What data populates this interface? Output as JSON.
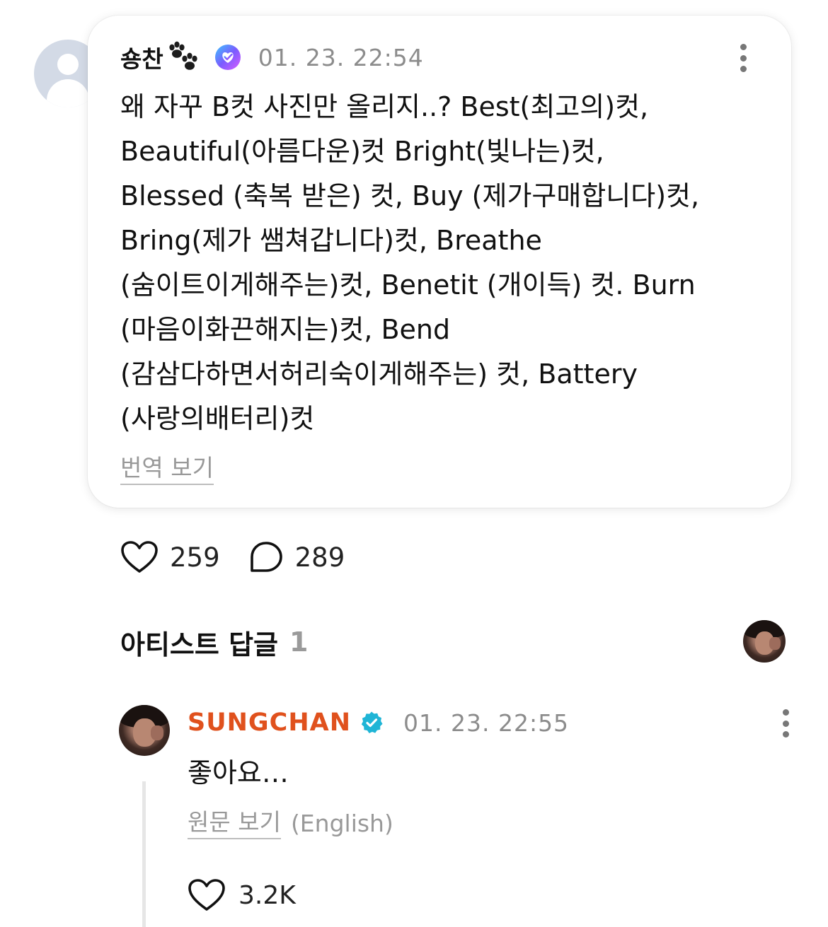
{
  "comment": {
    "author": "숑찬",
    "author_emoji": "paw-prints-icon",
    "badge_icon": "verified-fan-badge-icon",
    "time": "01. 23. 22:54",
    "lines": [
      "왜 자꾸 B컷 사진만 올리지..? Best(최고의)컷,",
      "Beautiful(아름다운)컷 Bright(빛나는)컷,",
      "Blessed (축복 받은) 컷, Buy (제가구매합니다)컷,",
      "Bring(제가 쌤쳐갑니다)컷, Breathe",
      "(숨이트이게해주는)컷, Benetit (개이득) 컷. Burn",
      "(마음이화끈해지는)컷, Bend",
      "(감삼다하면서허리숙이게해주는) 컷, Battery",
      "(사랑의배터리)컷"
    ],
    "translate_label": "번역 보기",
    "likes": "259",
    "replies": "289"
  },
  "artist_replies": {
    "title": "아티스트 답글",
    "count": "1"
  },
  "reply": {
    "author": "SUNGCHAN",
    "time": "01. 23. 22:55",
    "text": "좋아요…",
    "original_label": "원문 보기",
    "original_lang": "(English)",
    "likes": "3.2K"
  },
  "colors": {
    "artist_name": "#e0511d",
    "artist_badge": "#1fb5d6",
    "muted_text": "#8c8c8c"
  }
}
